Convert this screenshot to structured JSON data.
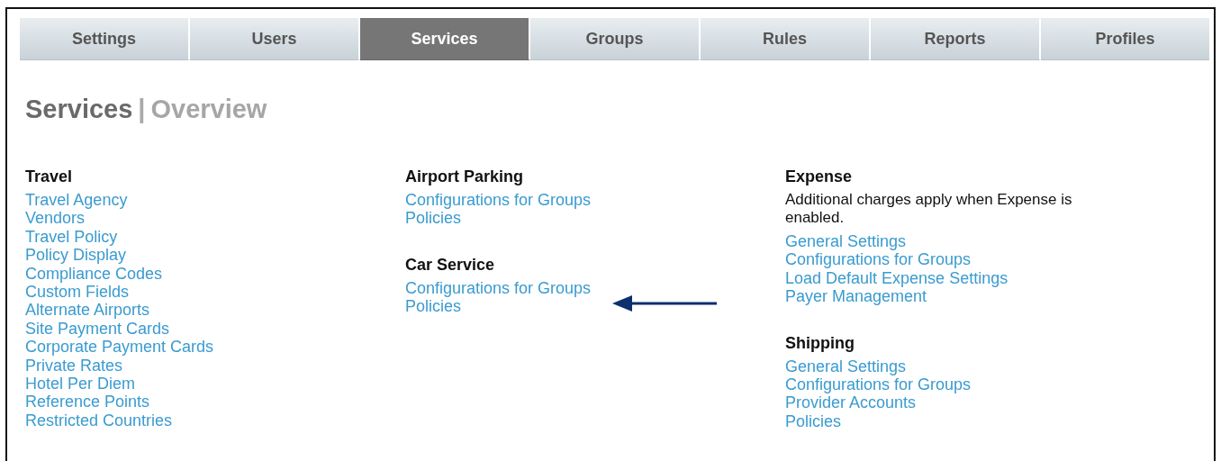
{
  "tabs": [
    {
      "label": "Settings",
      "selected": false
    },
    {
      "label": "Users",
      "selected": false
    },
    {
      "label": "Services",
      "selected": true
    },
    {
      "label": "Groups",
      "selected": false
    },
    {
      "label": "Rules",
      "selected": false
    },
    {
      "label": "Reports",
      "selected": false
    },
    {
      "label": "Profiles",
      "selected": false
    }
  ],
  "page_title": {
    "section": "Services",
    "separator": "|",
    "page": "Overview"
  },
  "columns": [
    {
      "sections": [
        {
          "heading": "Travel",
          "links": [
            "Travel Agency",
            "Vendors",
            "Travel Policy",
            "Policy Display",
            "Compliance Codes",
            "Custom Fields",
            "Alternate Airports",
            "Site Payment Cards",
            "Corporate Payment Cards",
            "Private Rates",
            "Hotel Per Diem",
            "Reference Points",
            "Restricted Countries"
          ]
        }
      ]
    },
    {
      "sections": [
        {
          "heading": "Airport Parking",
          "links": [
            "Configurations for Groups",
            "Policies"
          ]
        },
        {
          "heading": "Car Service",
          "links": [
            "Configurations for Groups",
            "Policies"
          ]
        }
      ]
    },
    {
      "sections": [
        {
          "heading": "Expense",
          "note": "Additional charges apply when Expense is enabled.",
          "links": [
            "General Settings",
            "Configurations for Groups",
            "Load Default Expense Settings",
            "Payer Management"
          ]
        },
        {
          "heading": "Shipping",
          "links": [
            "General Settings",
            "Configurations for Groups",
            "Provider Accounts",
            "Policies"
          ]
        }
      ]
    }
  ]
}
